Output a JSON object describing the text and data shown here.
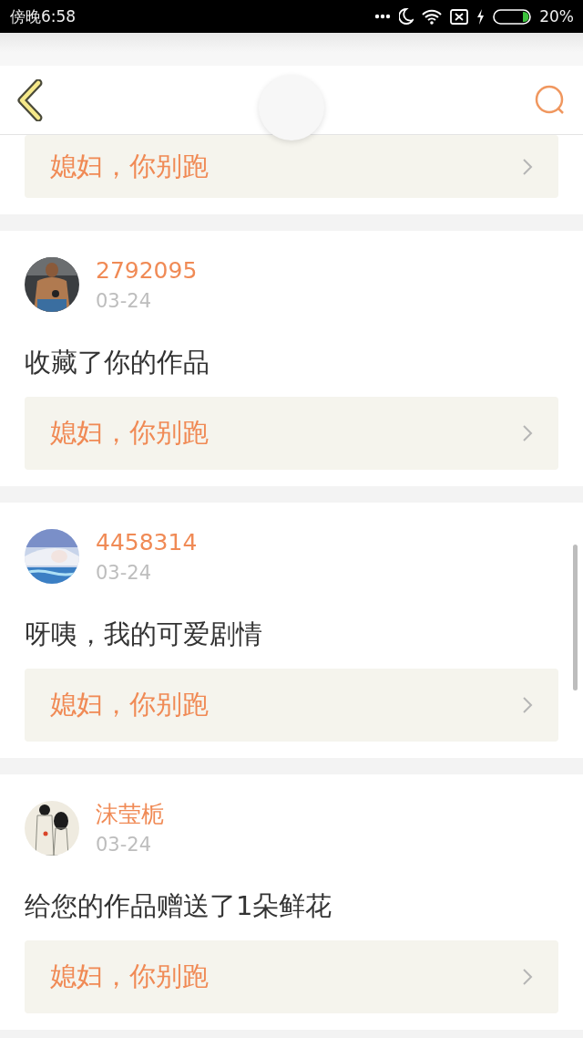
{
  "status_bar": {
    "time": "傍晚6:58",
    "battery": "20%"
  },
  "top_item": {
    "work_title": "媳妇，你别跑"
  },
  "notifications": [
    {
      "user": "2792095",
      "date": "03-24",
      "message": "收藏了你的作品",
      "work_title": "媳妇，你别跑"
    },
    {
      "user": "4458314",
      "date": "03-24",
      "message": "呀咦，我的可爱剧情",
      "work_title": "媳妇，你别跑"
    },
    {
      "user": "沫莹栀",
      "date": "03-24",
      "message": "给您的作品赠送了1朵鲜花",
      "work_title": "媳妇，你别跑"
    }
  ]
}
